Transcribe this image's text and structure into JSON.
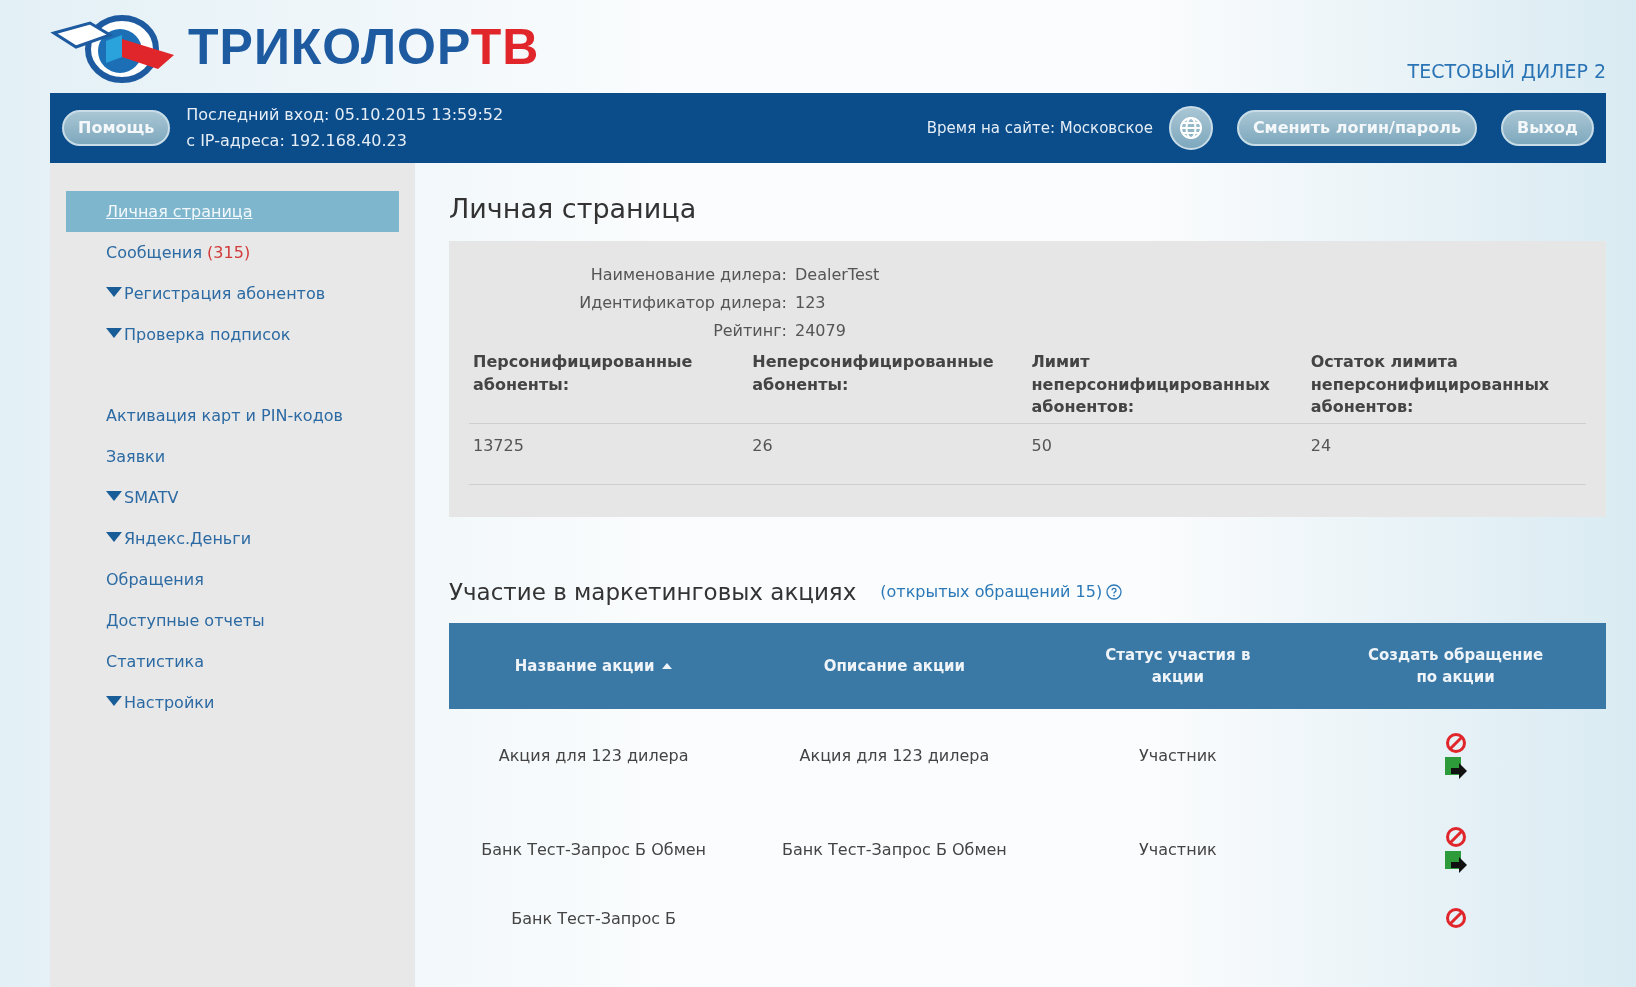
{
  "logo": {
    "main": "ТРИКОЛОР",
    "accent": "ТВ"
  },
  "dealer_label": "ТЕСТОВЫЙ ДИЛЕР 2",
  "top_bar": {
    "help_button": "Помощь",
    "last_login": "Последний вход: 05.10.2015 13:59:52",
    "ip": "с IP-адреса: 192.168.40.23",
    "time_zone": "Время на сайте: Московское",
    "change_button": "Сменить логин/пароль",
    "logout_button": "Выход"
  },
  "sidebar": {
    "items": [
      {
        "label": "Личная страница",
        "selected": true
      },
      {
        "label": "Сообщения",
        "count": "(315)",
        "selected": false
      },
      {
        "label": "Регистрация абонентов",
        "expandable": true,
        "selected": false
      },
      {
        "label": "Проверка подписок",
        "expandable": true,
        "selected": false,
        "gap_after": true
      },
      {
        "label": "Активация карт и PIN-кодов",
        "selected": false
      },
      {
        "label": "Заявки",
        "selected": false
      },
      {
        "label": "SMATV",
        "expandable": true,
        "selected": false
      },
      {
        "label": "Яндекс.Деньги",
        "expandable": true,
        "selected": false
      },
      {
        "label": "Обращения",
        "selected": false
      },
      {
        "label": "Доступные отчеты",
        "selected": false
      },
      {
        "label": "Статистика",
        "selected": false
      },
      {
        "label": "Настройки",
        "expandable": true,
        "selected": false
      }
    ]
  },
  "page_title": "Личная страница",
  "dealer_info": {
    "fields": [
      {
        "label": "Наименование дилера:",
        "value": "DealerTest"
      },
      {
        "label": "Идентификатор дилера:",
        "value": "123"
      },
      {
        "label": "Рейтинг:",
        "value": "24079"
      }
    ],
    "columns": [
      "Персонифицированные абоненты:",
      "Неперсонифицированные абоненты:",
      "Лимит неперсонифицированных абонентов:",
      "Остаток лимита неперсонифицированных абонентов:"
    ],
    "values": [
      "13725",
      "26",
      "50",
      "24"
    ]
  },
  "promotions": {
    "title": "Участие в маркетинговых акциях",
    "open_requests": "(открытых обращений 15)",
    "columns": [
      {
        "label": "Название акции",
        "sorted": true,
        "ascending": true
      },
      {
        "label": "Описание акции"
      },
      {
        "label": "Статус участия в акции"
      },
      {
        "label": "Создать обращение по акции"
      }
    ],
    "rows": [
      {
        "name": "Акция для 123 дилера",
        "description": "Акция для 123 дилера",
        "status": "Участник"
      },
      {
        "name": "Банк Тест-Запрос Б Обмен",
        "description": "Банк Тест-Запрос Б Обмен",
        "status": "Участник"
      },
      {
        "name": "Банк Тест-Запрос Б"
      }
    ]
  }
}
